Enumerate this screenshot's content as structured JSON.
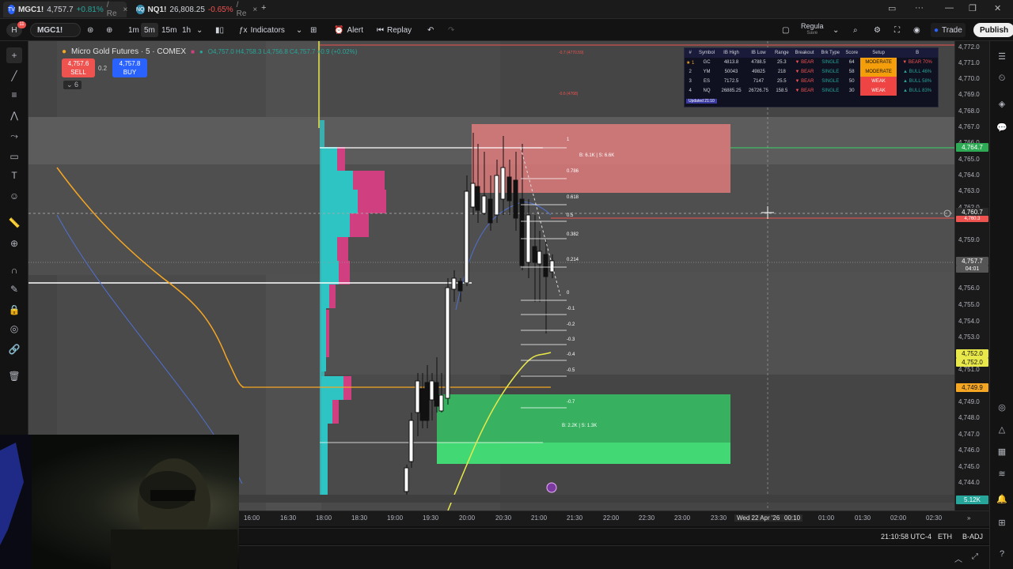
{
  "browser": {
    "tabs": [
      {
        "symbol": "MGC1!",
        "price": "4,757.7",
        "change": "+0.81%",
        "suffix": "/ Re",
        "close": "×"
      },
      {
        "symbol": "NQ1!",
        "price": "26,808.25",
        "change": "-0.65%",
        "suffix": "/ Re",
        "close": "×"
      }
    ],
    "new_tab": "+"
  },
  "toolbar": {
    "symbol": "MGC1!",
    "intervals": [
      "1m",
      "5m",
      "15m",
      "1h"
    ],
    "selected_interval": "5m",
    "indicators_label": "Indicators",
    "alert_label": "Alert",
    "replay_label": "Replay",
    "layout_label": "Regula",
    "layout_sub": "Save",
    "trade_label": "Trade",
    "publish_label": "Publish",
    "notif_badge": "11"
  },
  "legend": {
    "title": "Micro Gold Futures · 5 · COMEX",
    "open": "O4,757.0",
    "high": "H4,758.3",
    "low": "L4,756.8",
    "close": "C4,757.7",
    "change": "+0.9 (+0.02%)",
    "sell_price": "4,757.6",
    "sell_label": "SELL",
    "spread": "0.2",
    "buy_price": "4,757.8",
    "buy_label": "BUY",
    "indicator_count": "6"
  },
  "scanner": {
    "headers": [
      "#",
      "Symbol",
      "IB High",
      "IB Low",
      "Range",
      "Breakout",
      "Brk Type",
      "Score",
      "Setup",
      "B"
    ],
    "rows": [
      {
        "rank": "★ 1",
        "symbol": "GC",
        "ib_high": "4813.8",
        "ib_low": "4788.5",
        "range": "25.3",
        "breakout": "▼ BEAR",
        "brk_type": "SINGLE",
        "score": "64",
        "setup": "MODERATE",
        "bias": "▼ BEAR 70%"
      },
      {
        "rank": "2",
        "symbol": "YM",
        "ib_high": "50043",
        "ib_low": "49825",
        "range": "218",
        "breakout": "▼ BEAR",
        "brk_type": "SINGLE",
        "score": "58",
        "setup": "MODERATE",
        "bias": "▲ BULL 46%"
      },
      {
        "rank": "3",
        "symbol": "ES",
        "ib_high": "7172.5",
        "ib_low": "7147",
        "range": "25.5",
        "breakout": "▼ BEAR",
        "brk_type": "SINGLE",
        "score": "50",
        "setup": "WEAK",
        "bias": "▲ BULL 58%"
      },
      {
        "rank": "4",
        "symbol": "NQ",
        "ib_high": "26885.25",
        "ib_low": "26726.75",
        "range": "158.5",
        "breakout": "▼ BEAR",
        "brk_type": "SINGLE",
        "score": "30",
        "setup": "WEAK",
        "bias": "▲ BULL 83%"
      }
    ],
    "footer": "Updated 21:10"
  },
  "fib_levels": [
    "1",
    "0.786",
    "0.618",
    "0.5",
    "0.382",
    "0.214",
    "0",
    "-0.1",
    "-0.2",
    "-0.3",
    "-0.4",
    "-0.5",
    "-0.7"
  ],
  "zones": {
    "supply_label": "B: 6.1K | S: 6.6K",
    "demand_label": "B: 2.2K | S: 1.3K",
    "top_note_1": "-0.7 (4770.59)",
    "top_note_2": "-0.6 (4768)"
  },
  "price_axis": {
    "labels": [
      "4,772.0",
      "4,771.0",
      "4,770.0",
      "4,769.0",
      "4,768.0",
      "4,767.0",
      "4,766.0",
      "4,765.0",
      "4,764.0",
      "4,763.0",
      "4,762.0",
      "4,761.0",
      "4,760.0",
      "4,759.0",
      "4,758.0",
      "4,757.0",
      "4,756.0",
      "4,755.0",
      "4,754.0",
      "4,753.0",
      "4,752.0",
      "4,751.0",
      "4,750.0",
      "4,749.0",
      "4,748.0",
      "4,747.0",
      "4,746.0",
      "4,745.0",
      "4,744.0"
    ],
    "tag_green": "4,764.7",
    "tag_cross": "4,760.7",
    "tag_red": "4,760.3",
    "tag_last": "4,757.7",
    "tag_countdown": "04:01",
    "tag_yellow_1": "4,752.0",
    "tag_yellow_2": "4,752.0",
    "tag_orange": "4,749.9",
    "tag_volume": "5.12K"
  },
  "time_axis": {
    "labels": [
      "16:00",
      "16:30",
      "18:00",
      "18:30",
      "19:00",
      "19:30",
      "20:00",
      "20:30",
      "21:00",
      "21:30",
      "22:00",
      "22:30",
      "23:00",
      "23:30",
      "Wed 22 Apr '26",
      "00:10",
      "01:00",
      "01:30",
      "02:00",
      "02:30"
    ]
  },
  "status": {
    "clock": "21:10:58 UTC-4",
    "session": "ETH",
    "adjust": "B-ADJ"
  },
  "colors": {
    "bg": "#454545",
    "supply": "#f08080",
    "demand": "#33cc66",
    "poc_cyan": "#2ec4c4",
    "poc_pink": "#d04080",
    "vwap_orange": "#f5a623",
    "ma_yellow": "#e8e84a"
  }
}
